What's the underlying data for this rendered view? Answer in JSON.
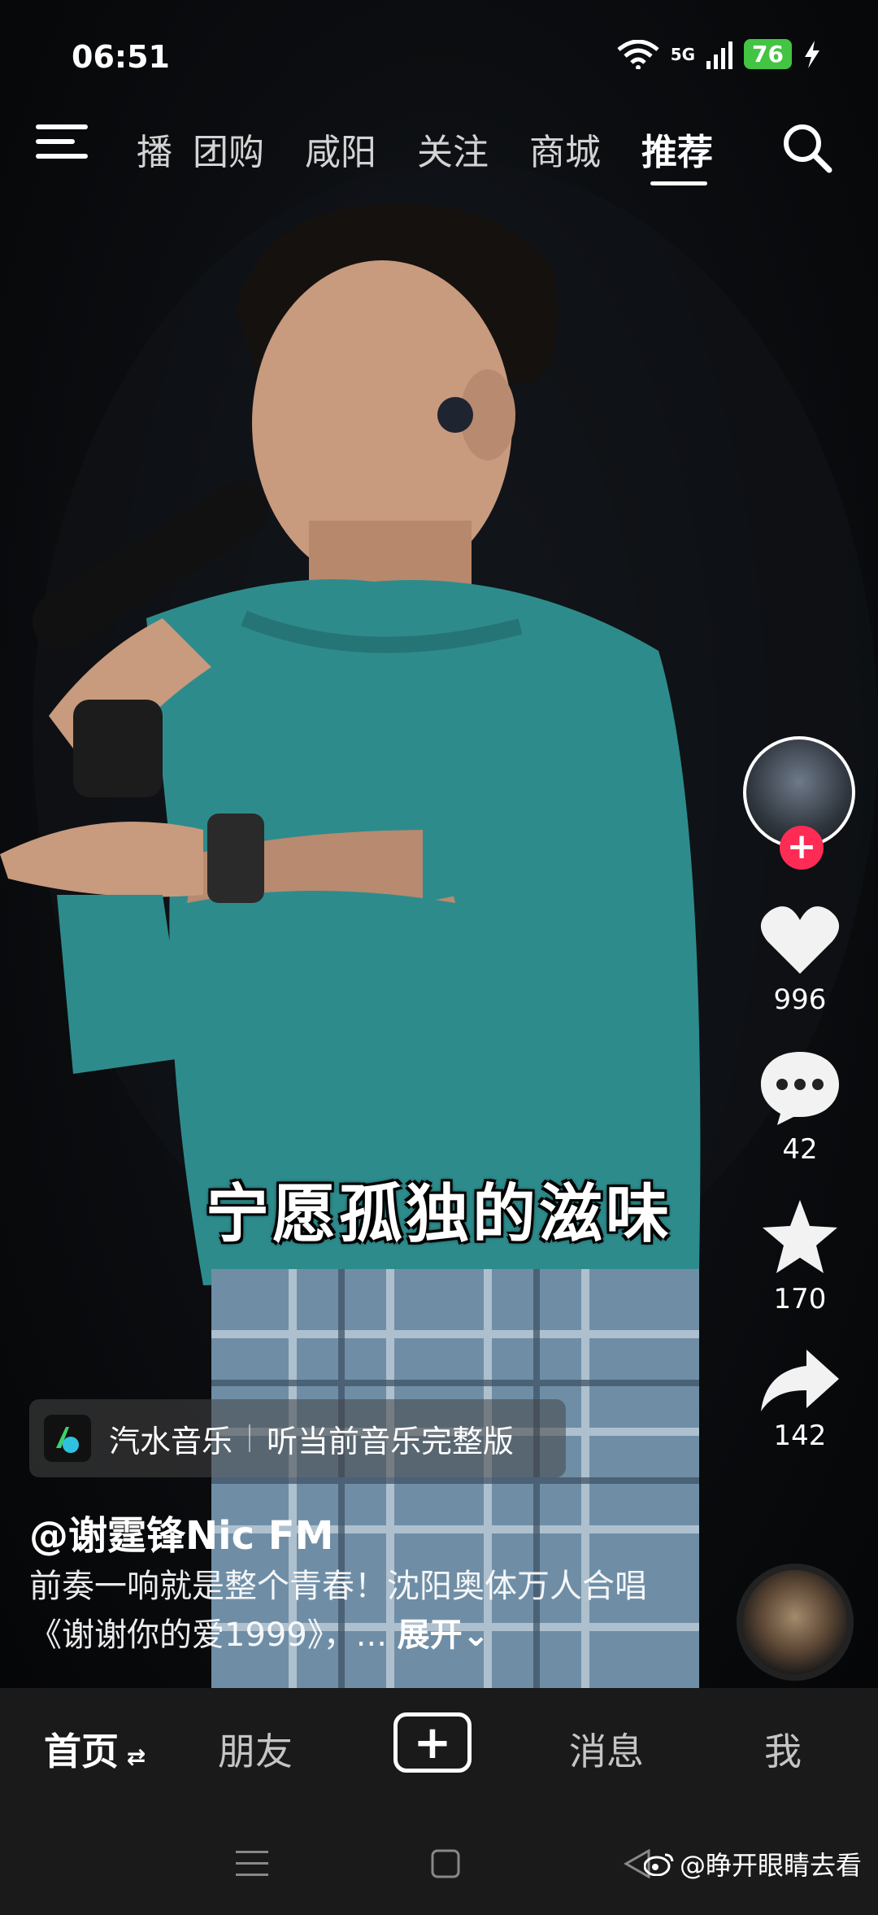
{
  "status_bar": {
    "time": "06:51",
    "battery": "76",
    "network": "5G"
  },
  "top_nav": {
    "tabs": [
      {
        "label": "播"
      },
      {
        "label": "团购"
      },
      {
        "label": "咸阳"
      },
      {
        "label": "关注"
      },
      {
        "label": "商城"
      },
      {
        "label": "推荐",
        "active": true
      }
    ]
  },
  "video": {
    "subtitle": "宁愿孤独的滋味"
  },
  "rail": {
    "follow_label": "+",
    "likes": "996",
    "comments": "42",
    "favorites": "170",
    "shares": "142"
  },
  "music_banner": {
    "app_name": "汽水音乐",
    "cta": "听当前音乐完整版"
  },
  "caption": {
    "author": "@谢霆锋Nic FM",
    "description": "前奏一响就是整个青春！沈阳奥体万人合唱《谢谢你的爱1999》，...",
    "expand": "展开"
  },
  "bottom_nav": {
    "home": "首页",
    "friends": "朋友",
    "create": "+",
    "messages": "消息",
    "me": "我"
  },
  "watermark": "@睁开眼睛去看",
  "colors": {
    "accent": "#fe2c55",
    "battery": "#43c443",
    "nav_bg": "#1a1a1a"
  }
}
